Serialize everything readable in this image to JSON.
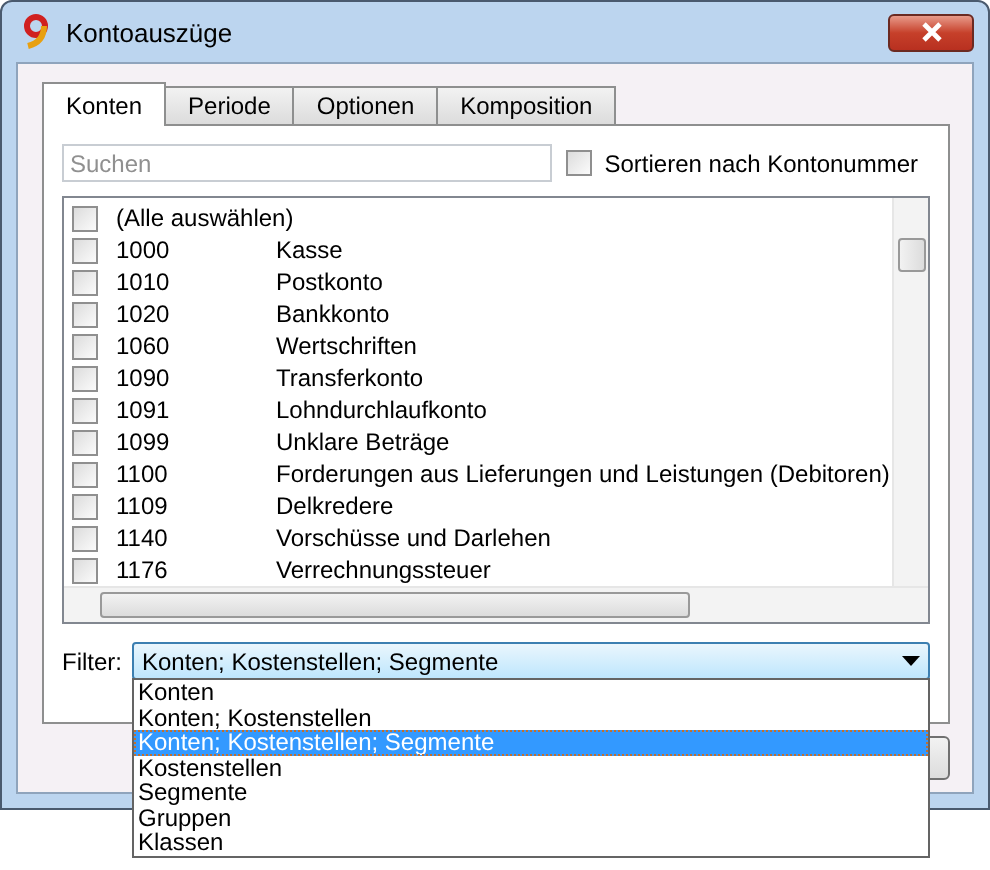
{
  "window": {
    "title": "Kontoauszüge"
  },
  "tabs": [
    {
      "label": "Konten",
      "selected": true
    },
    {
      "label": "Periode",
      "selected": false
    },
    {
      "label": "Optionen",
      "selected": false
    },
    {
      "label": "Komposition",
      "selected": false
    }
  ],
  "search": {
    "placeholder": "Suchen"
  },
  "sort_option": {
    "label": "Sortieren nach Kontonummer",
    "checked": false
  },
  "accounts": {
    "select_all": {
      "label": "(Alle auswählen)",
      "checked": false
    },
    "rows": [
      {
        "number": "1000",
        "name": "Kasse",
        "checked": false
      },
      {
        "number": "1010",
        "name": "Postkonto",
        "checked": false
      },
      {
        "number": "1020",
        "name": "Bankkonto",
        "checked": false
      },
      {
        "number": "1060",
        "name": "Wertschriften",
        "checked": false
      },
      {
        "number": "1090",
        "name": "Transferkonto",
        "checked": false
      },
      {
        "number": "1091",
        "name": "Lohndurchlaufkonto",
        "checked": false
      },
      {
        "number": "1099",
        "name": "Unklare Beträge",
        "checked": false
      },
      {
        "number": "1100",
        "name": "Forderungen aus Lieferungen und Leistungen (Debitoren)",
        "checked": false
      },
      {
        "number": "1109",
        "name": "Delkredere",
        "checked": false
      },
      {
        "number": "1140",
        "name": "Vorschüsse und Darlehen",
        "checked": false
      },
      {
        "number": "1176",
        "name": "Verrechnungssteuer",
        "checked": false
      }
    ]
  },
  "filter": {
    "label": "Filter:",
    "value": "Konten; Kostenstellen; Segmente",
    "expanded": true,
    "options": [
      {
        "label": "Konten",
        "selected": false
      },
      {
        "label": "Konten; Kostenstellen",
        "selected": false
      },
      {
        "label": "Konten; Kostenstellen; Segmente",
        "selected": true
      },
      {
        "label": "Kostenstellen",
        "selected": false
      },
      {
        "label": "Segmente",
        "selected": false
      },
      {
        "label": "Gruppen",
        "selected": false
      },
      {
        "label": "Klassen",
        "selected": false
      }
    ]
  }
}
